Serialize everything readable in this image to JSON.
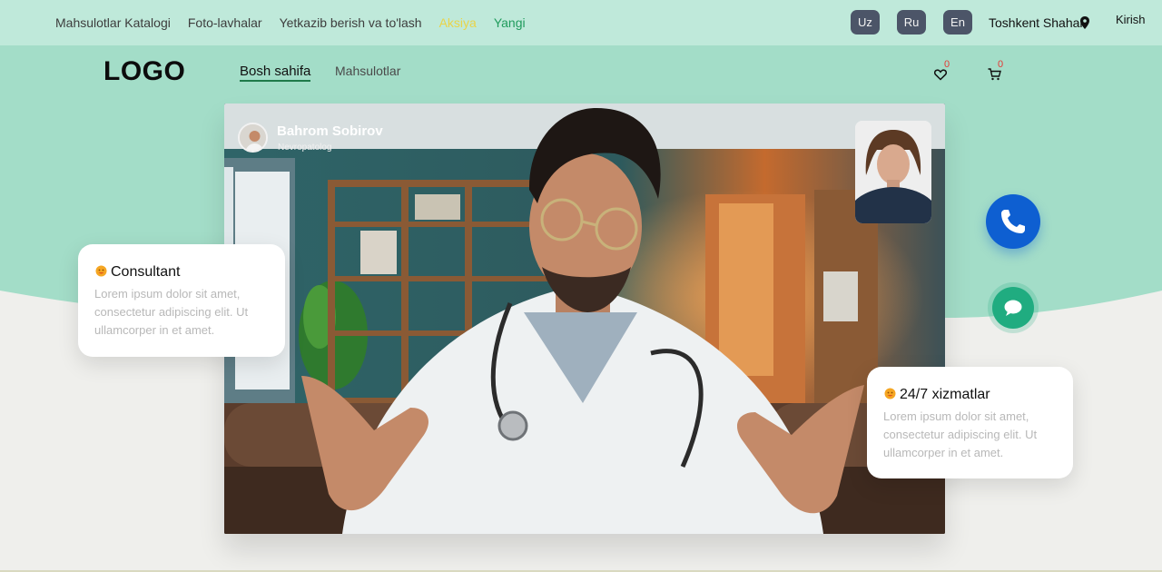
{
  "topbar": {
    "links": [
      "Mahsulotlar Katalogi",
      "Foto-lavhalar",
      "Yetkazib berish va to'lash",
      "Aksiya",
      "Yangi"
    ],
    "languages": [
      "Uz",
      "Ru",
      "En"
    ],
    "city": "Toshkent Shahar",
    "login": "Kirish"
  },
  "header": {
    "logo": "LOGO",
    "nav_home": "Bosh sahifa",
    "nav_products": "Mahsulotlar",
    "wishlist_count": "0",
    "cart_count": "0"
  },
  "video": {
    "host_name": "Bahrom Sobirov",
    "host_role": "Nevropatolog"
  },
  "cards": {
    "consultant": {
      "title": "Consultant",
      "text": "Lorem ipsum dolor sit amet, consectetur adipiscing elit. Ut ullamcorper in et amet."
    },
    "service": {
      "title": "24/7 xizmatlar",
      "text": "Lorem ipsum dolor sit amet, consectetur adipiscing elit. Ut ullamcorper in et amet."
    }
  },
  "colors": {
    "topbar": "#bfe9da",
    "hero_green": "#a3ddc8",
    "call": "#0e5fd1",
    "chat": "#20ac80",
    "sale": "#e9d449",
    "new": "#1f9b5c"
  },
  "icons": [
    "location-pin-icon",
    "heart-icon",
    "cart-icon",
    "phone-icon",
    "chat-icon",
    "emoji-icon"
  ]
}
